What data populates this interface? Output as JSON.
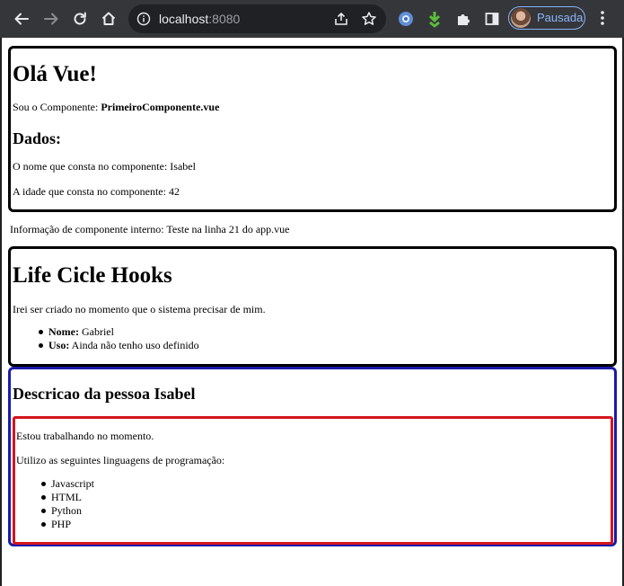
{
  "browser": {
    "url_host": "localhost",
    "url_port": ":8080",
    "profile_label": "Pausada",
    "icons": [
      "back-icon",
      "forward-icon",
      "reload-icon",
      "home-icon",
      "info-icon",
      "share-icon",
      "star-icon",
      "extension-blue-icon",
      "download-arrow-icon",
      "puzzle-icon",
      "sidebar-icon",
      "more-icon"
    ],
    "colors": {
      "toolbar": "#35363a",
      "omnibox": "#202124",
      "profile_accent": "#8ab4f8"
    }
  },
  "page": {
    "primeiro": {
      "title": "Olá Vue!",
      "intro_prefix": "Sou o Componente: ",
      "intro_component": "PrimeiroComponente.vue",
      "dados_title": "Dados:",
      "nome_line": "O nome que consta no componente: Isabel",
      "idade_line": "A idade que consta no componente: 42"
    },
    "info_interno": "Informação de componente interno: Teste na linha 21 do app.vue",
    "hooks": {
      "title": "Life Cicle Hooks",
      "text": "Irei ser criado no momento que o sistema precisar de mim.",
      "items": [
        {
          "label": "Nome:",
          "value": " Gabriel"
        },
        {
          "label": "Uso:",
          "value": " Ainda não tenho uso definido"
        }
      ]
    },
    "pessoa": {
      "title": "Descricao da pessoa Isabel",
      "status": "Estou trabalhando no momento.",
      "languages_intro": "Utilizo as seguintes linguagens de programação:",
      "languages": [
        "Javascript",
        "HTML",
        "Python",
        "PHP"
      ]
    },
    "colors": {
      "border_black": "#000000",
      "border_blue": "#1a1aa8",
      "border_red": "#d4151e"
    }
  }
}
